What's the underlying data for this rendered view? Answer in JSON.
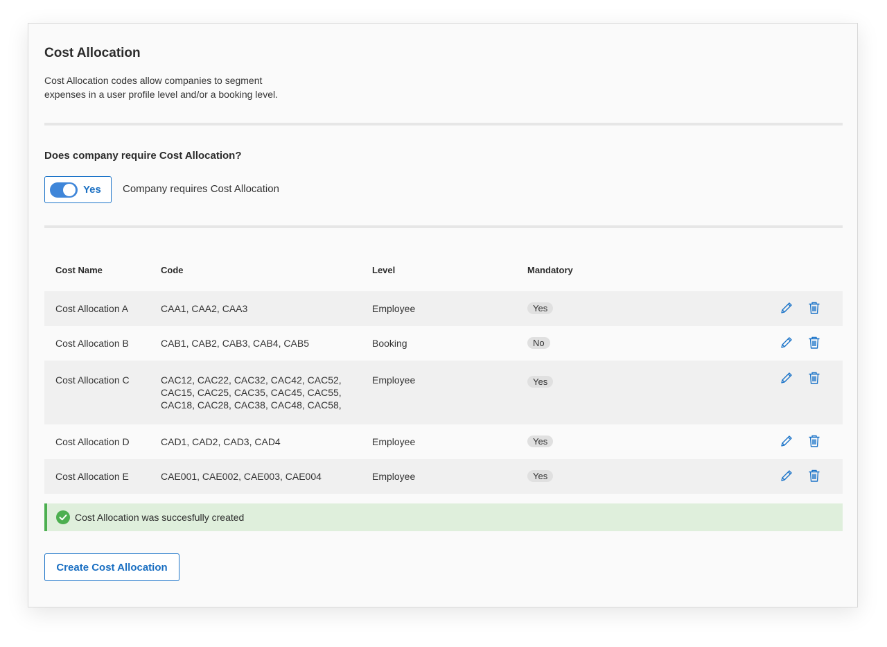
{
  "header": {
    "title": "Cost Allocation",
    "description": "Cost Allocation codes allow companies to segment expenses in a user profile level and/or a booking level."
  },
  "requirement": {
    "question": "Does company require Cost Allocation?",
    "toggle_label": "Yes",
    "toggle_on": true,
    "toggle_description": "Company requires Cost Allocation"
  },
  "table": {
    "headers": {
      "name": "Cost Name",
      "code": "Code",
      "level": "Level",
      "mandatory": "Mandatory"
    },
    "rows": [
      {
        "name": "Cost Allocation A",
        "code": "CAA1, CAA2, CAA3",
        "level": "Employee",
        "mandatory": "Yes"
      },
      {
        "name": "Cost Allocation B",
        "code": "CAB1, CAB2, CAB3, CAB4, CAB5",
        "level": "Booking",
        "mandatory": "No"
      },
      {
        "name": "Cost Allocation C",
        "code": "CAC12, CAC22, CAC32, CAC42, CAC52, CAC15, CAC25, CAC35, CAC45, CAC55, CAC18, CAC28, CAC38, CAC48, CAC58,",
        "level": "Employee",
        "mandatory": "Yes"
      },
      {
        "name": "Cost Allocation D",
        "code": "CAD1, CAD2, CAD3, CAD4",
        "level": "Employee",
        "mandatory": "Yes"
      },
      {
        "name": "Cost Allocation E",
        "code": "CAE001, CAE002, CAE003, CAE004",
        "level": "Employee",
        "mandatory": "Yes"
      }
    ]
  },
  "alert": {
    "message": "Cost Allocation was succesfully created"
  },
  "actions": {
    "create_label": "Create Cost Allocation"
  },
  "colors": {
    "accent": "#1a73c8",
    "success": "#4caf50",
    "success_bg": "#dfefdc"
  },
  "icons": {
    "edit": "pencil-icon",
    "delete": "trash-icon",
    "success": "check-circle-icon"
  }
}
